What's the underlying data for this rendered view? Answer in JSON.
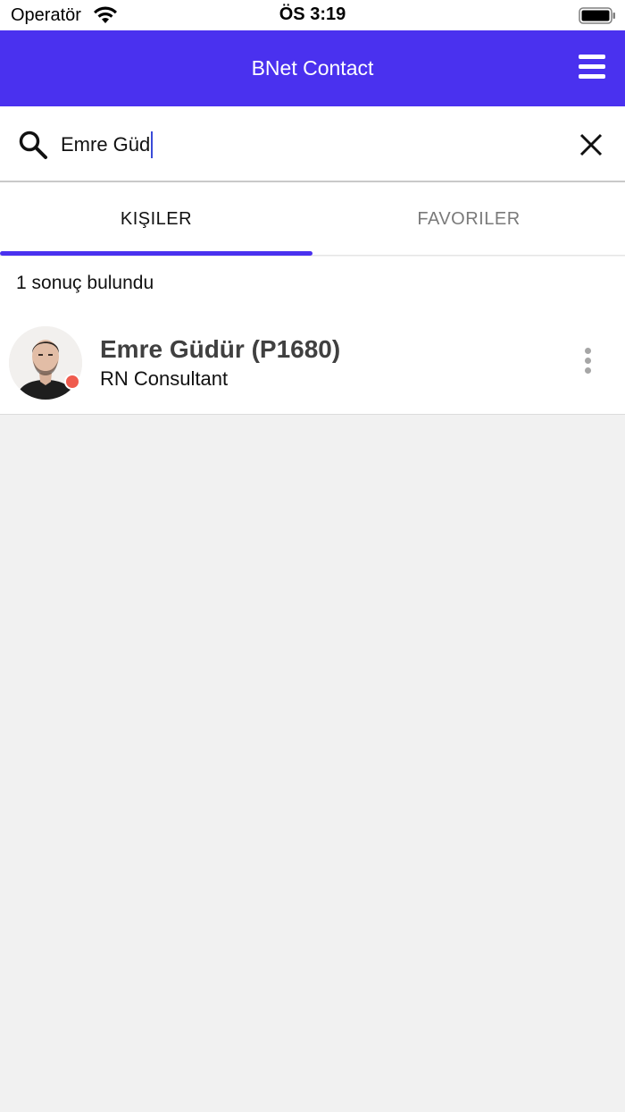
{
  "status_bar": {
    "carrier": "Operatör",
    "time": "ÖS 3:19"
  },
  "app_bar": {
    "title": "BNet Contact"
  },
  "search": {
    "value": "Emre Güd"
  },
  "tabs": [
    {
      "label": "KIŞILER",
      "active": true
    },
    {
      "label": "FAVORILER",
      "active": false
    }
  ],
  "results": {
    "count_text": "1 sonuç bulundu",
    "items": [
      {
        "name": "Emre Güdür (P1680)",
        "title": "RN Consultant",
        "status_color": "#ef5b4e"
      }
    ]
  },
  "colors": {
    "primary": "#4a31ef",
    "background": "#f1f1f1",
    "status_busy": "#ef5b4e"
  },
  "icons": [
    "wifi-icon",
    "battery-icon",
    "menu-icon",
    "search-icon",
    "close-icon",
    "more-vertical-icon"
  ]
}
